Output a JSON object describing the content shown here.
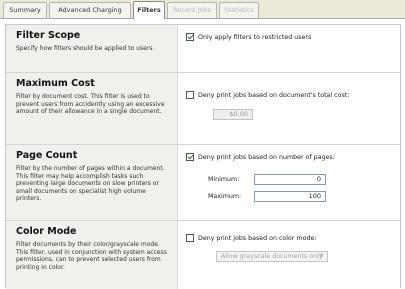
{
  "tabs": [
    {
      "label": "Summary"
    },
    {
      "label": "Advanced Charging"
    },
    {
      "label": "Filters"
    },
    {
      "label": "Recent Jobs"
    },
    {
      "label": "Statistics"
    }
  ],
  "filter_scope": {
    "title": "Filter Scope",
    "description": "Specify how filters should be applied to users.",
    "checkbox_label": "Only apply filters to restricted users",
    "checked": true
  },
  "maximum_cost": {
    "title": "Maximum Cost",
    "description": "Filter by document cost. This filter is used to prevent users from accidently using an excessive amount of their allowance in a single document.",
    "checkbox_label": "Deny print jobs based on document's total cost:",
    "checked": false,
    "cost_value": "$0.00"
  },
  "page_count": {
    "title": "Page Count",
    "description": "Filter by the number of pages within a document. This filter may help accomplish tasks such preventing large documents on slow printers or small documents on specialist high volume printers.",
    "checkbox_label": "Deny print jobs based on number of pages:",
    "checked": true,
    "minimum_label": "Minimum:",
    "minimum_value": "0",
    "maximum_label": "Maximum:",
    "maximum_value": "100"
  },
  "color_mode": {
    "title": "Color Mode",
    "description": "Filter documents by their color/grayscale mode. This filter, used in conjunction with system access permissions, can to prevent selected users from printing in color.",
    "checkbox_label": "Deny print jobs based on color mode:",
    "checked": false,
    "select_value": "Allow grayscale documents only"
  }
}
